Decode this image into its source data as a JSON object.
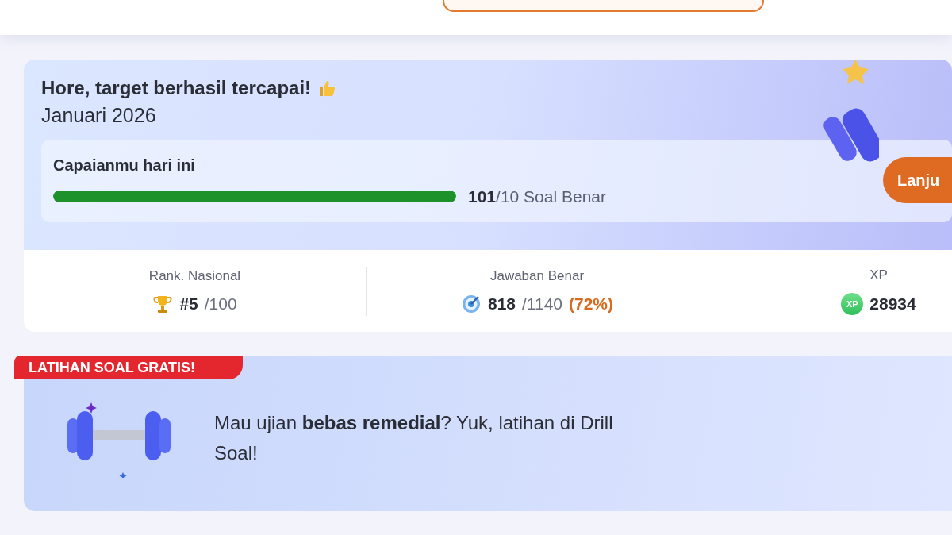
{
  "target_card": {
    "title": "Hore, target berhasil tercapai!",
    "period": "Januari 2026",
    "progress": {
      "label": "Capaianmu hari ini",
      "level": 1,
      "count": "101",
      "goal": "/10 Soal Benar"
    },
    "button": "Lanju"
  },
  "stats": [
    {
      "kind": "rank",
      "label": "Rank. Nasional",
      "value": "#5",
      "total": "/100"
    },
    {
      "kind": "answers",
      "label": "Jawaban Benar",
      "value": "818",
      "total": "/1140",
      "percent": "(72%)"
    },
    {
      "kind": "xp",
      "label": "XP",
      "badge": "XP",
      "value": "28934"
    }
  ],
  "promo": {
    "tag": "LATIHAN SOAL GRATIS!",
    "text": "Mau ujian **bebas remedial**? Yuk, latihan di Drill Soal!"
  }
}
